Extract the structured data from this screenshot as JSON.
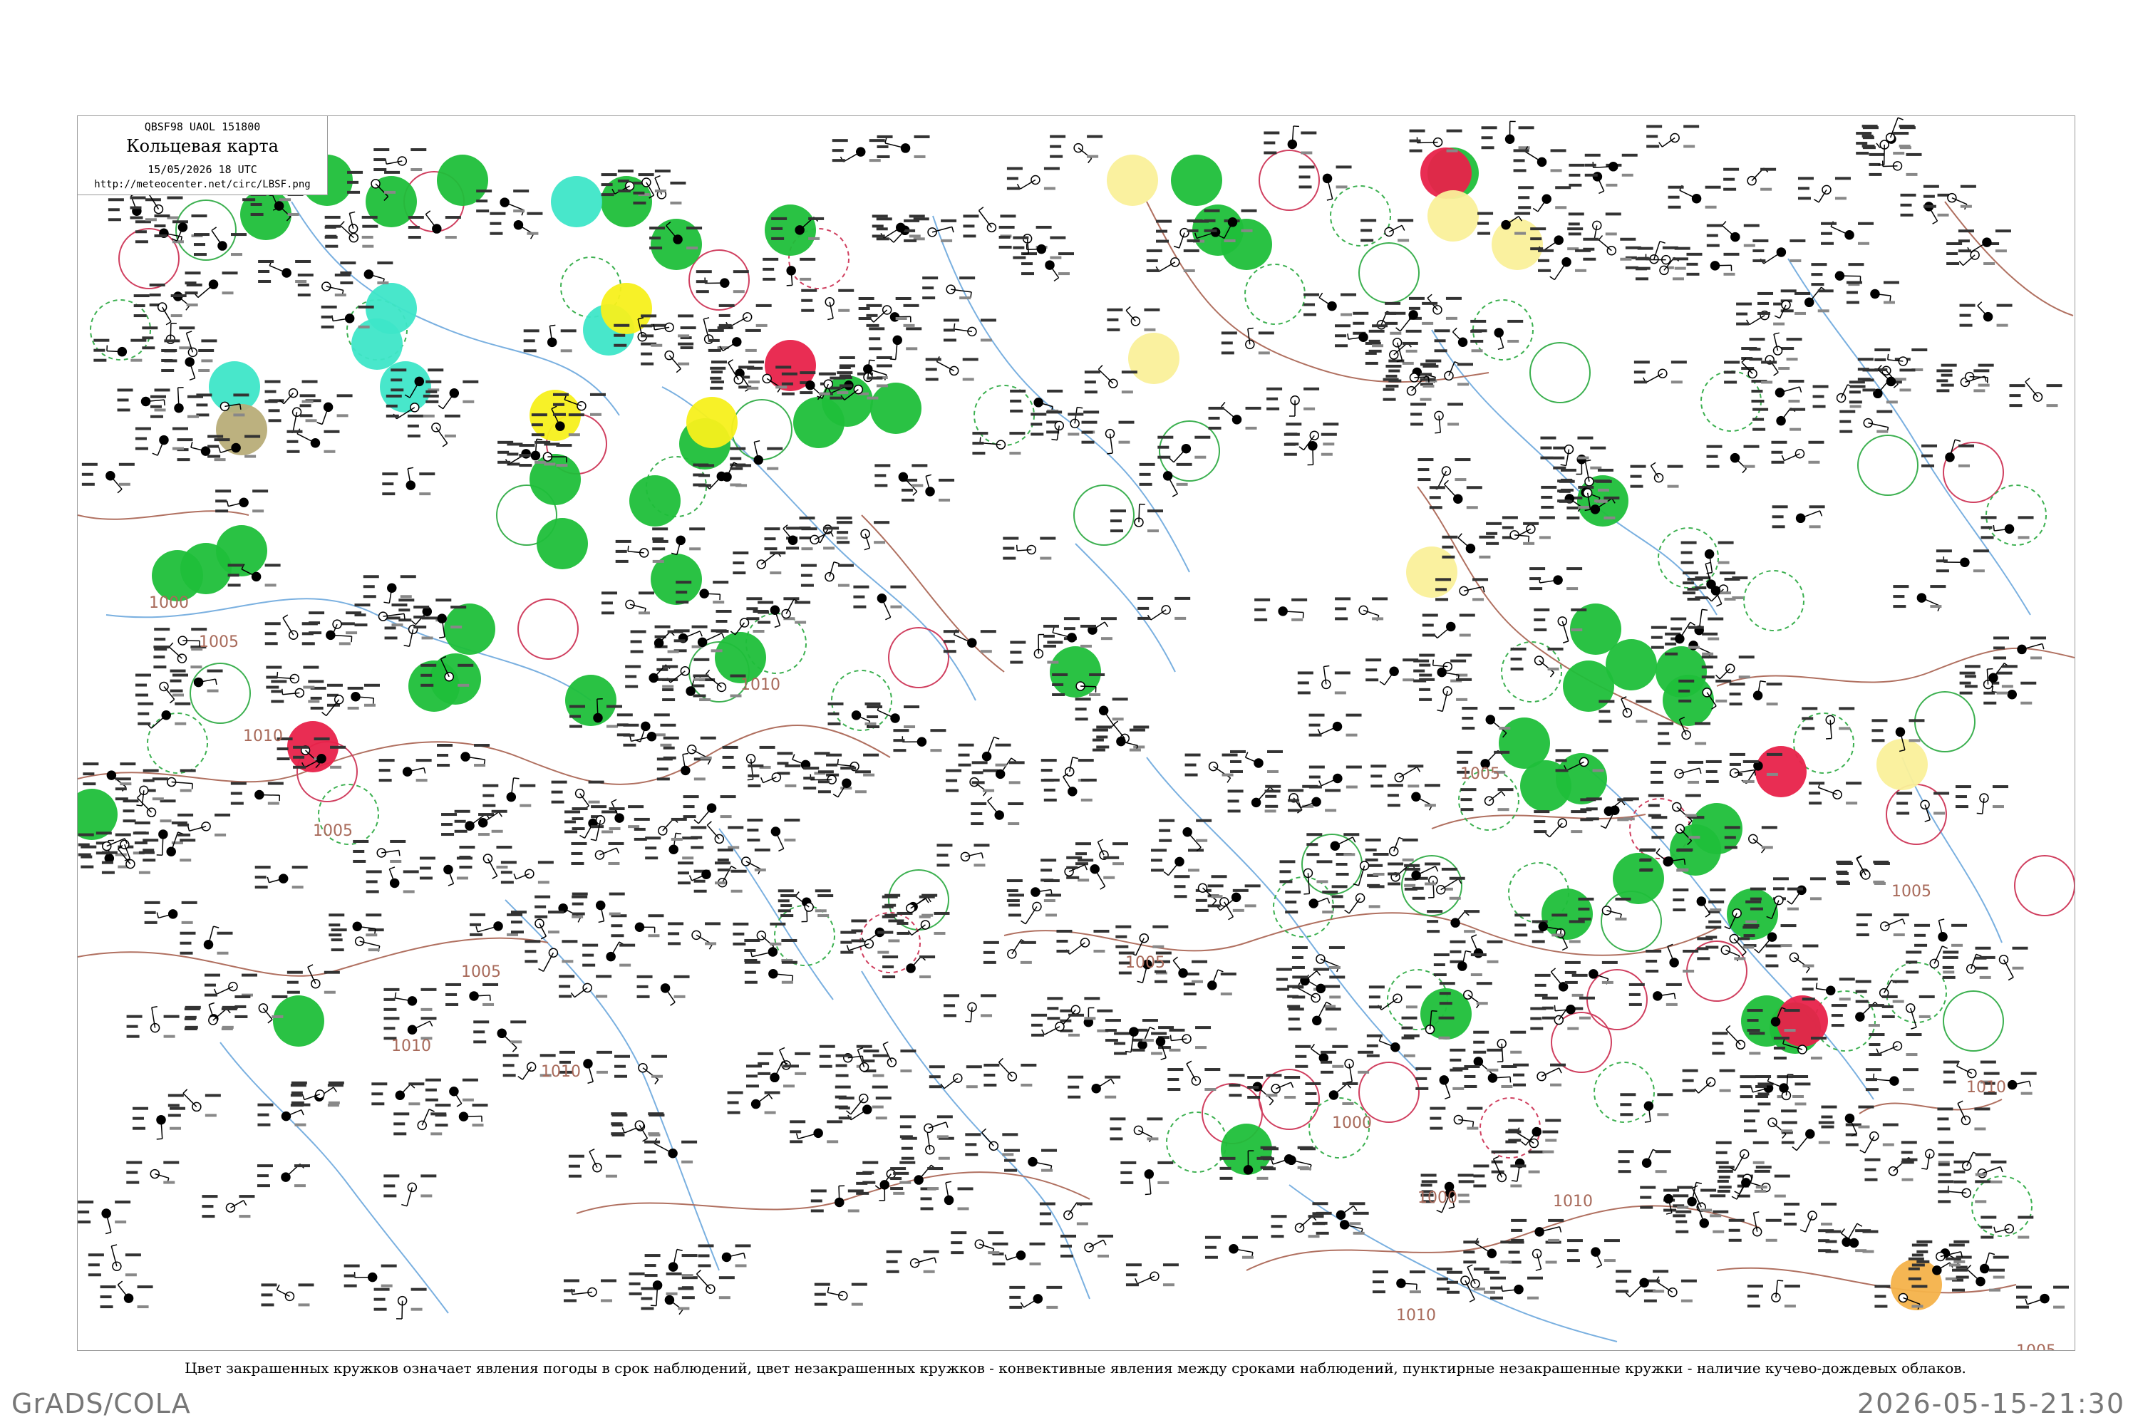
{
  "header": {
    "code": "QBSF98  UAOL  151800",
    "title": "Кольцевая карта",
    "datetime": "15/05/2026 18 UTC",
    "url": "http://meteocenter.net/circ/LBSF.png"
  },
  "isobar_labels": [
    "1000",
    "1005",
    "1010",
    "1005",
    "1010",
    "1005",
    "1010",
    "1010",
    "1005",
    "1000",
    "1005",
    "1010",
    "1010",
    "1005",
    "1010",
    "1005",
    "1000"
  ],
  "colors": {
    "green": "#1fbf3a",
    "yellow": "#f7f01c",
    "red": "#e8224a",
    "cyan": "#3ee6c8",
    "olive": "#b8ad78",
    "light_yellow": "#faf09a",
    "orange": "#f4b24a",
    "isobar": "#b07060",
    "river": "#7ab0e0",
    "ring_green": "#3cb050",
    "ring_red": "#d04060"
  },
  "caption": "Цвет закрашенных кружков означает явления погоды в срок наблюдений, цвет незакрашенных кружков - конвективные явления между сроками наблюдений, пунктирные незакрашенные кружки - наличие кучево-дождевых облаков.",
  "footer": {
    "software": "GrADS/COLA",
    "timestamp": "2026-05-15-21:30"
  }
}
